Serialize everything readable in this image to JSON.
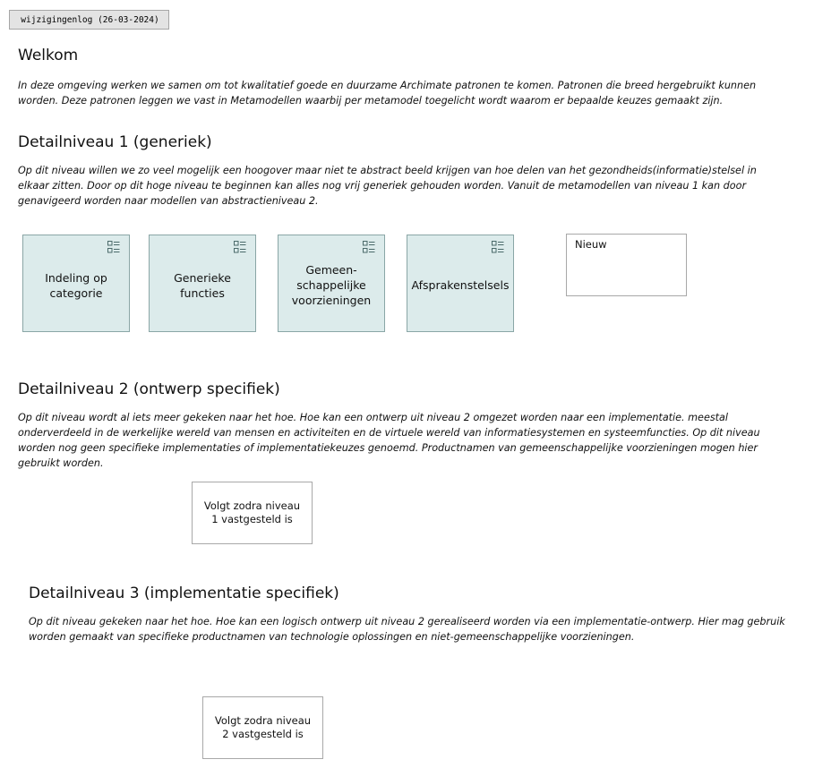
{
  "changelog": {
    "label": "wijzigingenlog (26-03-2024)"
  },
  "welcome": {
    "title": "Welkom",
    "text": "In deze omgeving werken we samen om tot kwalitatief goede en duurzame Archimate patronen te komen. Patronen die breed hergebruikt kunnen worden. Deze patronen leggen we vast in Metamodellen waarbij per metamodel toegelicht wordt waarom er bepaalde keuzes gemaakt zijn."
  },
  "level1": {
    "title": "Detailniveau 1 (generiek)",
    "text": "Op dit niveau willen we zo veel mogelijk een hoogover maar niet te abstract beeld krijgen van hoe delen van het gezondheids(informatie)stelsel in elkaar zitten. Door op dit hoge niveau te beginnen kan alles nog vrij generiek gehouden worden. Vanuit de metamodellen van niveau 1 kan door genavigeerd worden naar modellen van abstractieniveau 2.",
    "views": [
      {
        "label": "Indeling op categorie",
        "icon": "view-reference-icon"
      },
      {
        "label": "Generieke functies",
        "icon": "view-reference-icon"
      },
      {
        "label": "Gemeen-schappelijke voorzieningen",
        "icon": "view-reference-icon"
      },
      {
        "label": "Afsprakenstelsels",
        "icon": "view-reference-icon"
      }
    ],
    "note": "Nieuw"
  },
  "level2": {
    "title": "Detailniveau 2 (ontwerp specifiek)",
    "text": "Op dit niveau wordt al iets meer gekeken naar het hoe. Hoe kan een ontwerp uit niveau 2 omgezet worden naar een implementatie. meestal onderverdeeld in de werkelijke wereld van mensen en activiteiten en de virtuele wereld van informatiesystemen en systeemfuncties. Op dit niveau worden nog geen specifieke implementaties of implementatiekeuzes genoemd. Productnamen van gemeenschappelijke voorzieningen mogen hier gebruikt worden.",
    "note": "Volgt zodra niveau 1 vastgesteld is"
  },
  "level3": {
    "title": "Detailniveau 3 (implementatie specifiek)",
    "text": "Op dit niveau gekeken naar het hoe. Hoe kan een logisch ontwerp uit niveau 2 gerealiseerd worden via een implementatie-ontwerp. Hier mag gebruik worden gemaakt van specifieke productnamen van technologie oplossingen en niet-gemeenschappelijke voorzieningen.",
    "note": "Volgt zodra niveau 2 vastgesteld is"
  },
  "colors": {
    "element_fill": "#dcebeb",
    "element_border": "#8aa6a6",
    "icon_color": "#4a6a6a"
  }
}
